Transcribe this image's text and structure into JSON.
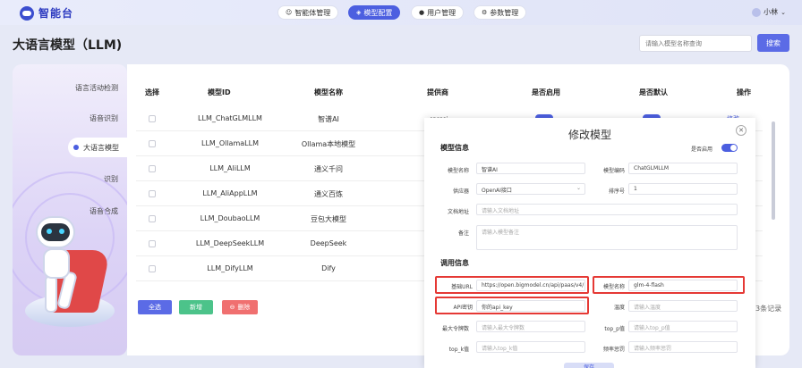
{
  "app": {
    "title": "智能台"
  },
  "nav": {
    "tabs": [
      {
        "label": "智能体管理",
        "icon": "robot-icon"
      },
      {
        "label": "模型配置",
        "icon": "cube-icon"
      },
      {
        "label": "用户管理",
        "icon": "user-icon"
      },
      {
        "label": "参数管理",
        "icon": "settings-icon"
      }
    ]
  },
  "user": {
    "name": "小林"
  },
  "page": {
    "title": "大语言模型（LLM)"
  },
  "search": {
    "placeholder": "请输入模型名称查询",
    "button_label": "搜索"
  },
  "sidebar": {
    "items": [
      {
        "label": "语言活动检测"
      },
      {
        "label": "语音识别"
      },
      {
        "label": "大语言模型"
      },
      {
        "label": "识别"
      },
      {
        "label": "语音合成"
      }
    ]
  },
  "table": {
    "headers": [
      "选择",
      "模型ID",
      "模型名称",
      "提供商",
      "是否启用",
      "是否默认",
      "操作"
    ],
    "rows": [
      {
        "id": "LLM_ChatGLMLLM",
        "name": "智谱AI"
      },
      {
        "id": "LLM_OllamaLLM",
        "name": "Ollama本地模型"
      },
      {
        "id": "LLM_AliLLM",
        "name": "通义千问"
      },
      {
        "id": "LLM_AliAppLLM",
        "name": "通义百炼"
      },
      {
        "id": "LLM_DoubaoLLM",
        "name": "豆包大模型"
      },
      {
        "id": "LLM_DeepSeekLLM",
        "name": "DeepSeek"
      },
      {
        "id": "LLM_DifyLLM",
        "name": "Dify"
      }
    ],
    "partial_text": {
      "provider_fragment": "openai",
      "op_fragment": "修改",
      "edit_fragment": "辑"
    }
  },
  "actions": {
    "select_all": "全选",
    "add": "新增",
    "delete": "删除"
  },
  "pagination": {
    "total_text": "3条记录"
  },
  "modal": {
    "title": "修改模型",
    "model_info_title": "模型信息",
    "enabled_label": "是否启用",
    "fields": {
      "model_name": {
        "label": "模型名称",
        "value": "智谱AI"
      },
      "model_code": {
        "label": "模型编码",
        "value": "ChatGLMLLM"
      },
      "provider": {
        "label": "供应器",
        "value": "OpenAI接口"
      },
      "sort": {
        "label": "排序号",
        "value": "1"
      },
      "doc_url": {
        "label": "文档地址",
        "placeholder": "请输入文档地址"
      },
      "remark": {
        "label": "备注",
        "placeholder": "请输入模型备注"
      }
    },
    "call_info_title": "调用信息",
    "call_fields": {
      "base_url": {
        "label": "基础URL",
        "value": "https://open.bigmodel.cn/api/paas/v4/"
      },
      "model_name": {
        "label": "模型名称",
        "value": "glm-4-flash"
      },
      "api_key": {
        "label": "API密钥",
        "value": "你的api_key"
      },
      "temperature": {
        "label": "温度",
        "placeholder": "请输入温度"
      },
      "max_tokens": {
        "label": "最大令牌数",
        "placeholder": "请输入最大令牌数"
      },
      "top_p": {
        "label": "top_p值",
        "placeholder": "请输入top_p值"
      },
      "top_k": {
        "label": "top_k值",
        "placeholder": "请输入top_k值"
      },
      "frequency_penalty": {
        "label": "频率惩罚",
        "placeholder": "请输入频率惩罚"
      }
    },
    "save_fragment": "保存"
  },
  "colors": {
    "accent": "#4c5fe0",
    "highlight": "#e53935",
    "add": "#4cc38a",
    "delete": "#f07070"
  }
}
